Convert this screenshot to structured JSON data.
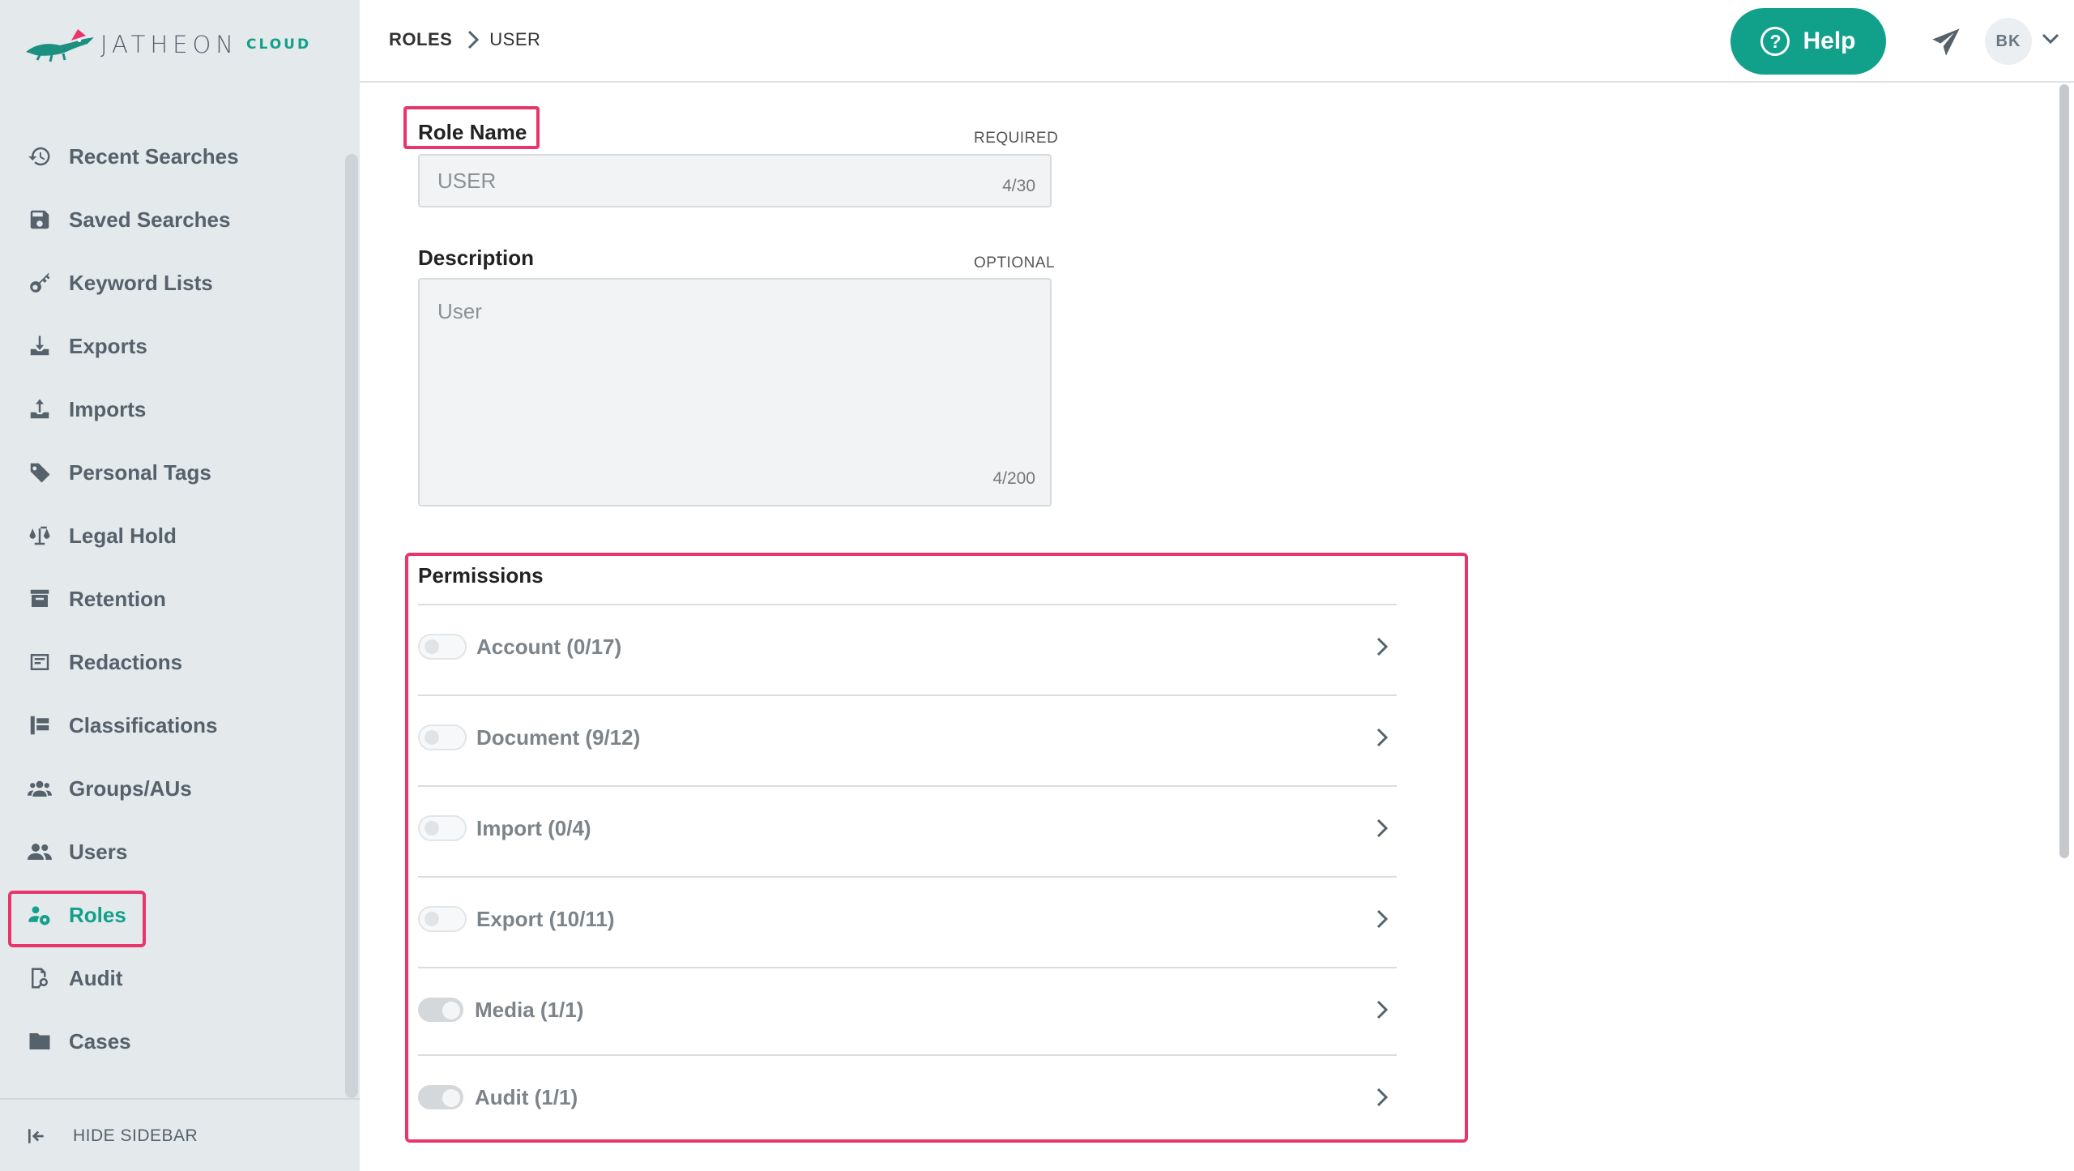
{
  "brand": {
    "name": "JATHEON",
    "suffix": "CLOUD",
    "accent": "#11a089",
    "highlight": "#e8356b"
  },
  "sidebar": {
    "items": [
      {
        "label": "Recent Searches",
        "icon": "history-icon"
      },
      {
        "label": "Saved Searches",
        "icon": "floppy-disk-icon"
      },
      {
        "label": "Keyword Lists",
        "icon": "key-icon"
      },
      {
        "label": "Exports",
        "icon": "download-tray-icon"
      },
      {
        "label": "Imports",
        "icon": "upload-tray-icon"
      },
      {
        "label": "Personal Tags",
        "icon": "tag-icon"
      },
      {
        "label": "Legal Hold",
        "icon": "scales-icon"
      },
      {
        "label": "Retention",
        "icon": "retention-icon"
      },
      {
        "label": "Redactions",
        "icon": "redaction-icon"
      },
      {
        "label": "Classifications",
        "icon": "classification-icon"
      },
      {
        "label": "Groups/AUs",
        "icon": "groups-icon"
      },
      {
        "label": "Users",
        "icon": "users-icon"
      },
      {
        "label": "Roles",
        "icon": "roles-icon",
        "active": true
      },
      {
        "label": "Audit",
        "icon": "audit-icon"
      },
      {
        "label": "Cases",
        "icon": "folder-icon"
      }
    ],
    "hide_label": "HIDE SIDEBAR"
  },
  "header": {
    "breadcrumb_root": "ROLES",
    "breadcrumb_current": "USER",
    "help_label": "Help",
    "avatar_initials": "BK"
  },
  "form": {
    "role_name": {
      "label": "Role Name",
      "tag": "REQUIRED",
      "value": "USER",
      "count": "4/30"
    },
    "description": {
      "label": "Description",
      "tag": "OPTIONAL",
      "value": "User",
      "count": "4/200"
    }
  },
  "permissions": {
    "title": "Permissions",
    "items": [
      {
        "label": "Account (0/17)",
        "on": false
      },
      {
        "label": "Document (9/12)",
        "on": false
      },
      {
        "label": "Import (0/4)",
        "on": false
      },
      {
        "label": "Export (10/11)",
        "on": false
      },
      {
        "label": "Media (1/1)",
        "on": true
      },
      {
        "label": "Audit (1/1)",
        "on": true
      }
    ]
  }
}
